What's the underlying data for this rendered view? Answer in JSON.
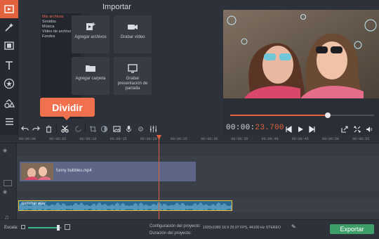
{
  "import": {
    "title": "Importar",
    "categories": [
      "Mis archivos",
      "Sonidos",
      "Música",
      "Vídeo de archivo",
      "Fondos"
    ],
    "tiles": [
      {
        "label": "Agregar archivos",
        "icon": "add-files-icon"
      },
      {
        "label": "Grabar vídeo",
        "icon": "camera-icon"
      },
      {
        "label": "Agregar carpeta",
        "icon": "folder-icon"
      },
      {
        "label": "Grabar presentación de pantalla",
        "icon": "screen-record-icon"
      }
    ]
  },
  "tooltip": {
    "text": "Dividir"
  },
  "player": {
    "timecode_white": "00:00:",
    "timecode_red": "23.700",
    "seek_fraction": 0.68
  },
  "timeline": {
    "ticks": [
      "00:00:00",
      "00:00:05",
      "00:00:10",
      "00:00:15",
      "00:00:20",
      "00:00:25",
      "00:00:30",
      "00:00:35",
      "00:00:40",
      "00:00:45",
      "00:00:50",
      "00:00:55"
    ],
    "video_clip": "funny bubbles.mp4",
    "audio_clip": "summer.wav"
  },
  "status": {
    "scale_label": "Escala:",
    "zoom_fraction": 0.9,
    "config_label": "Configuración del proyecto:",
    "config_value": "1920x1080 16:9 29.97 FPS, 44100 Hz STEREO",
    "duration_label": "Duración del proyecto:",
    "export_label": "Exportar"
  },
  "colors": {
    "accent": "#e2623e",
    "export": "#3e9e6a",
    "audio_clip": "#2a6a8f",
    "video_clip": "#5e6688"
  }
}
